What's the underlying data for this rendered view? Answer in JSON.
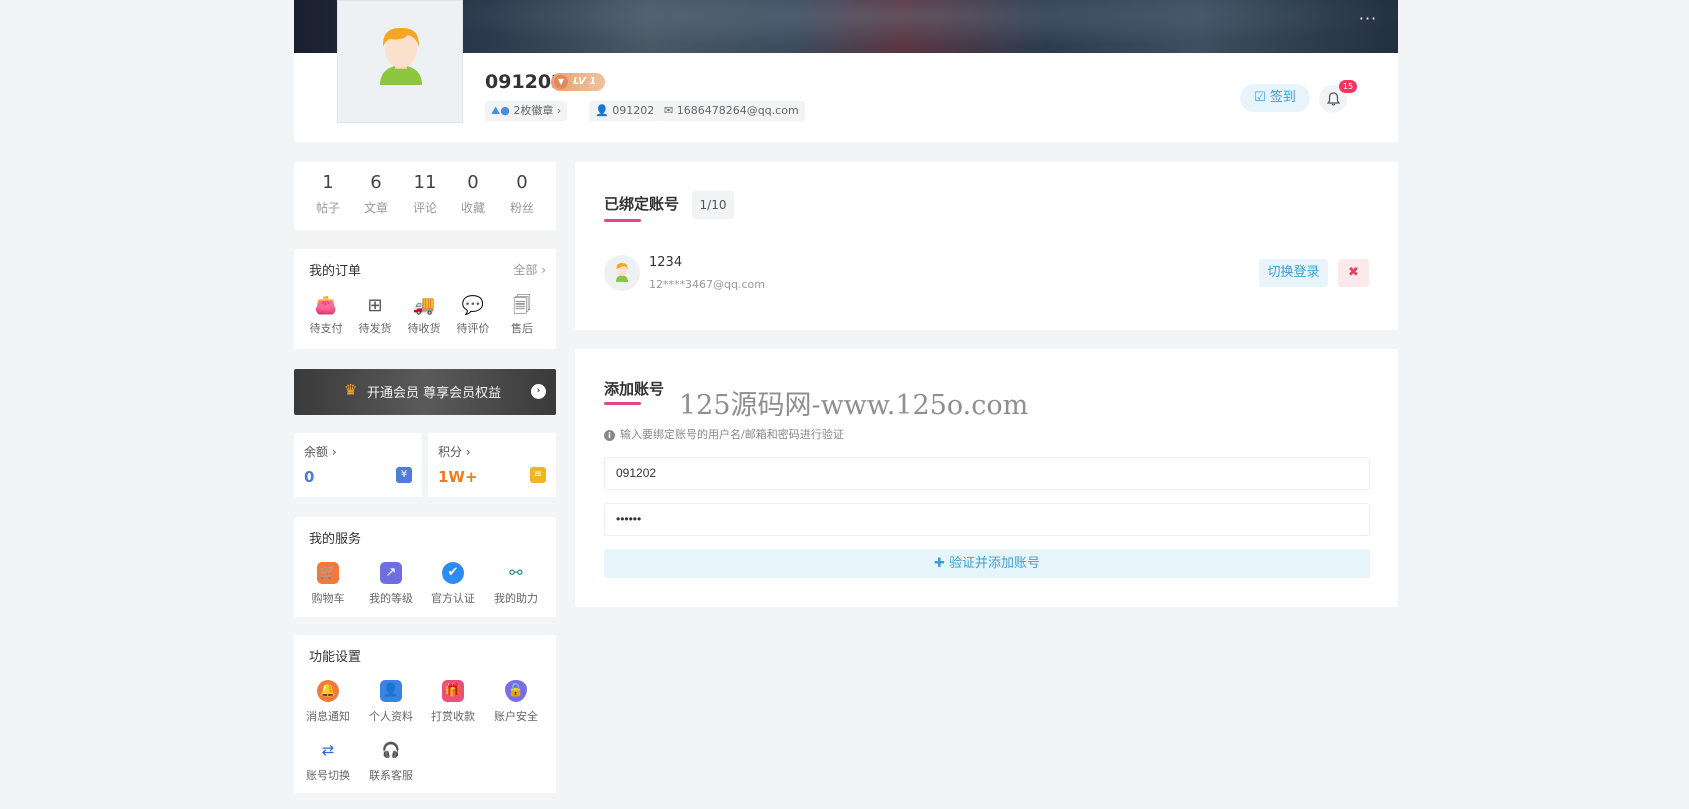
{
  "header": {
    "more_label": "···",
    "username": "091202",
    "level": "LV 1",
    "badges_label": "2枚徽章",
    "user_id": "091202",
    "email": "1686478264@qq.com",
    "signin_label": "签到",
    "notification_count": "15"
  },
  "stats": [
    {
      "value": "1",
      "label": "帖子"
    },
    {
      "value": "6",
      "label": "文章"
    },
    {
      "value": "11",
      "label": "评论"
    },
    {
      "value": "0",
      "label": "收藏"
    },
    {
      "value": "0",
      "label": "粉丝"
    }
  ],
  "orders": {
    "title": "我的订单",
    "more": "全部",
    "items": [
      "待支付",
      "待发货",
      "待收货",
      "待评价",
      "售后"
    ]
  },
  "vip": {
    "label": "开通会员 尊享会员权益"
  },
  "balance": {
    "label": "余额",
    "value": "0"
  },
  "points": {
    "label": "积分",
    "value": "1W+"
  },
  "services": {
    "title": "我的服务",
    "items": [
      "购物车",
      "我的等级",
      "官方认证",
      "我的助力"
    ]
  },
  "settings": {
    "title": "功能设置",
    "items": [
      "消息通知",
      "个人资料",
      "打赏收款",
      "账户安全",
      "账号切换",
      "联系客服"
    ]
  },
  "bound": {
    "title": "已绑定账号",
    "count": "1/10",
    "account": {
      "name": "1234",
      "email": "12****3467@qq.com"
    },
    "switch_label": "切换登录",
    "delete_label": "✖"
  },
  "add": {
    "title": "添加账号",
    "watermark": "125源码网-www.125o.com",
    "hint": "输入要绑定账号的用户名/邮箱和密码进行验证",
    "username_value": "091202",
    "password_value": "••••••",
    "submit_label": "验证并添加账号"
  },
  "colors": {
    "accent": "#3a9fd8",
    "underline": "#e6468a",
    "balance_value": "#4f7bd9",
    "points_value": "#f07c14",
    "badge": "#f5365c"
  }
}
